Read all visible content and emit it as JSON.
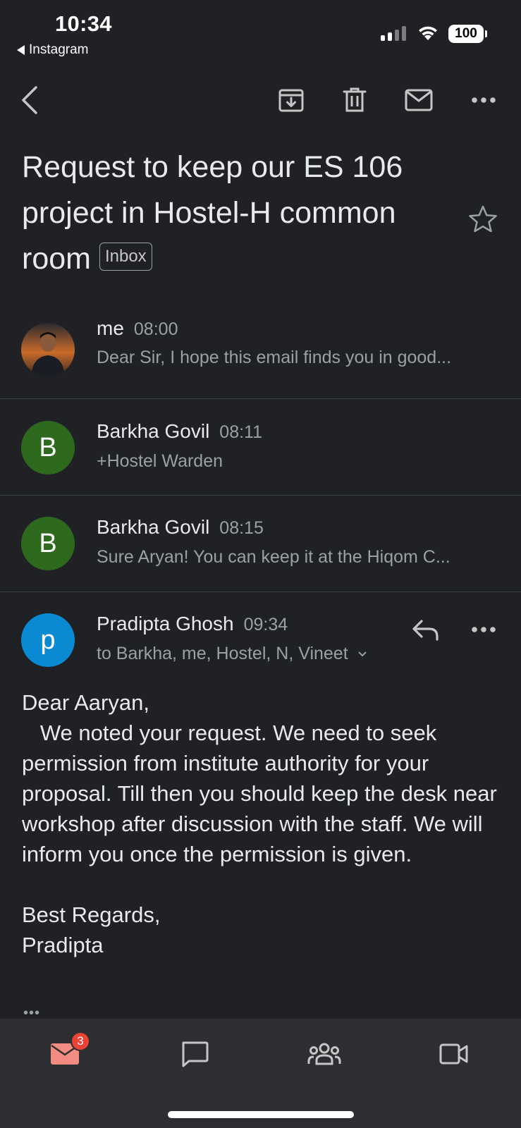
{
  "status_bar": {
    "time": "10:34",
    "back_app": "Instagram",
    "battery": "100"
  },
  "toolbar": {
    "icons": [
      "back-arrow-icon",
      "archive-icon",
      "trash-icon",
      "mail-icon",
      "more-icon"
    ]
  },
  "subject": {
    "text": "Request to keep our ES 106 project in Hostel-H common room",
    "label": "Inbox"
  },
  "messages": [
    {
      "sender": "me",
      "time": "08:00",
      "snippet": "Dear Sir, I hope this email finds you in good...",
      "avatar_letter": ""
    },
    {
      "sender": "Barkha Govil",
      "time": "08:11",
      "snippet": "+Hostel Warden",
      "avatar_letter": "B",
      "avatar_color": "#2d6a1e"
    },
    {
      "sender": "Barkha Govil",
      "time": "08:15",
      "snippet": "Sure Aryan! You can keep it at the Hiqom C...",
      "avatar_letter": "B",
      "avatar_color": "#2d6a1e"
    },
    {
      "sender": "Pradipta Ghosh",
      "time": "09:34",
      "recipients": "to Barkha, me, Hostel, N, Vineet",
      "avatar_letter": "p",
      "avatar_color": "#0b8ad4"
    }
  ],
  "open_message": {
    "greeting": "Dear Aaryan,",
    "body": "   We noted your request. We need to seek permission from institute authority for your proposal. Till then you should keep the desk near workshop after discussion with the staff. We will inform you once the permission is given.",
    "signoff": "Best Regards,",
    "signature": "Pradipta",
    "trimmed": "•••"
  },
  "bottom_nav": {
    "mail_badge": "3",
    "items": [
      "mail-icon",
      "chat-icon",
      "spaces-icon",
      "meet-icon"
    ]
  },
  "colors": {
    "background": "#202124",
    "nav_background": "#2d2e31",
    "accent_mail": "#f28b82",
    "badge": "#ea4335"
  }
}
